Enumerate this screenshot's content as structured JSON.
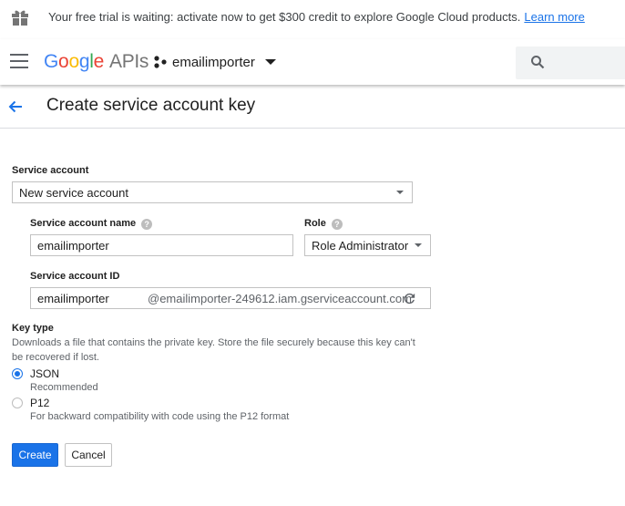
{
  "banner": {
    "icon": "gift-icon",
    "message": "Your free trial is waiting: activate now to get $300 credit to explore Google Cloud products.",
    "link": "Learn more"
  },
  "appbar": {
    "menu_icon": "hamburger-menu-icon",
    "logo_google": "Google",
    "logo_apis": "APIs",
    "project_icon": "project-dots-icon",
    "project_name": "emailimporter",
    "search_icon": "search-icon"
  },
  "header": {
    "back_icon": "arrow-back-icon",
    "title": "Create service account key"
  },
  "form": {
    "service_account": {
      "label": "Service account",
      "value": "New service account"
    },
    "name": {
      "label": "Service account name",
      "value": "emailimporter"
    },
    "role": {
      "label": "Role",
      "value": "Role Administrator"
    },
    "account_id": {
      "label": "Service account ID",
      "value": "emailimporter",
      "suffix": "@emailimporter-249612.iam.gserviceaccount.com",
      "refresh_icon": "refresh-icon"
    },
    "key_type": {
      "label": "Key type",
      "description": "Downloads a file that contains the private key. Store the file securely because this key can't be recovered if lost.",
      "options": [
        {
          "title": "JSON",
          "subtitle": "Recommended",
          "selected": true
        },
        {
          "title": "P12",
          "subtitle": "For backward compatibility with code using the P12 format",
          "selected": false
        }
      ]
    }
  },
  "buttons": {
    "create": "Create",
    "cancel": "Cancel"
  },
  "colors": {
    "accent": "#1a73e8",
    "google_blue": "#4285f4",
    "google_red": "#ea4335",
    "google_yellow": "#fbbc05",
    "google_green": "#34a853"
  }
}
